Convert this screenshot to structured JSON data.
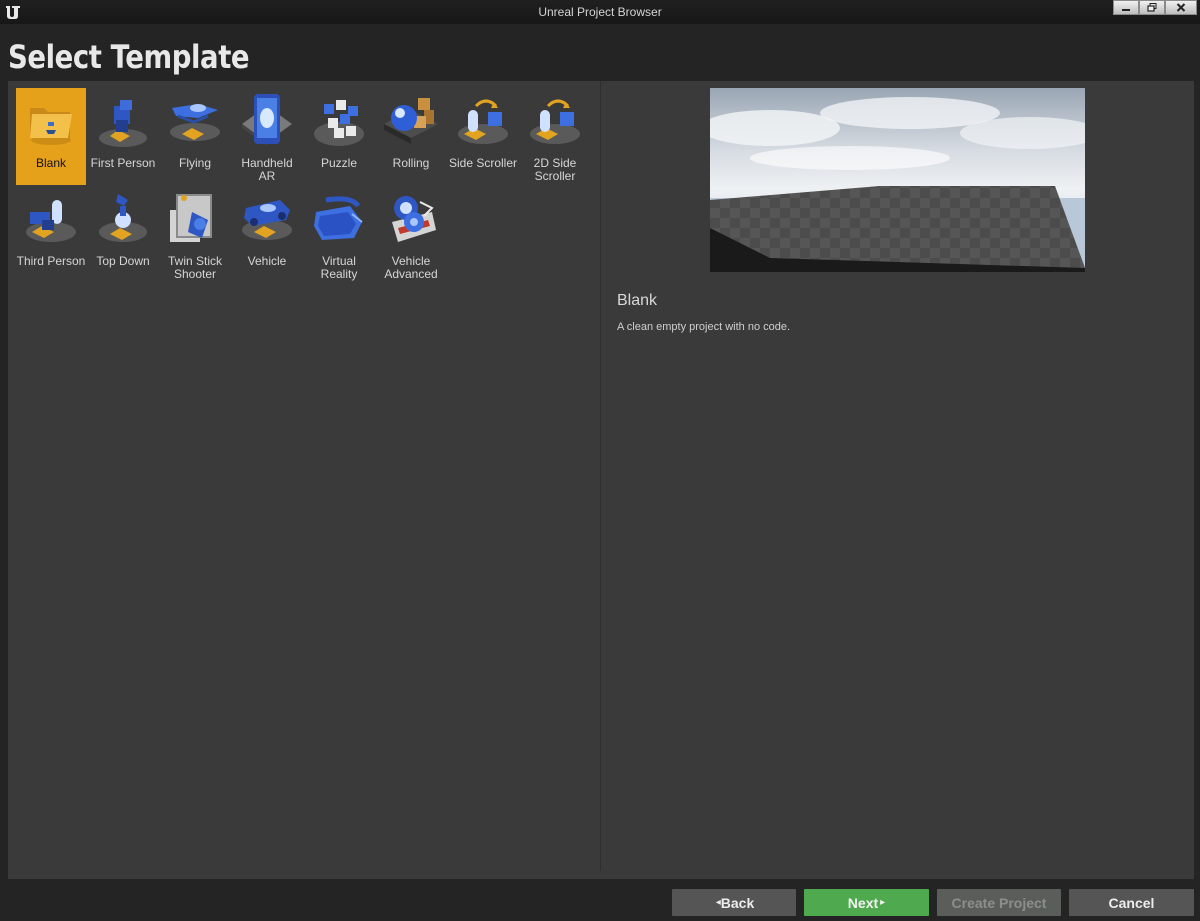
{
  "window": {
    "title": "Unreal Project Browser",
    "icons": [
      "ue-logo-icon",
      "minimize-icon",
      "restore-icon",
      "close-icon"
    ]
  },
  "page": {
    "title": "Select Template"
  },
  "templates": [
    {
      "label": "Blank",
      "icon": "folder-icon",
      "selected": true
    },
    {
      "label": "First Person",
      "icon": "first-person-icon",
      "selected": false
    },
    {
      "label": "Flying",
      "icon": "flying-icon",
      "selected": false
    },
    {
      "label": "Handheld AR",
      "icon": "handheld-ar-icon",
      "selected": false
    },
    {
      "label": "Puzzle",
      "icon": "puzzle-icon",
      "selected": false
    },
    {
      "label": "Rolling",
      "icon": "rolling-icon",
      "selected": false
    },
    {
      "label": "Side Scroller",
      "icon": "side-scroller-icon",
      "selected": false
    },
    {
      "label": "2D Side Scroller",
      "icon": "2d-side-scroller-icon",
      "selected": false
    },
    {
      "label": "Third Person",
      "icon": "third-person-icon",
      "selected": false
    },
    {
      "label": "Top Down",
      "icon": "top-down-icon",
      "selected": false
    },
    {
      "label": "Twin Stick Shooter",
      "icon": "twin-stick-shooter-icon",
      "selected": false
    },
    {
      "label": "Vehicle",
      "icon": "vehicle-icon",
      "selected": false
    },
    {
      "label": "Virtual Reality",
      "icon": "vr-headset-icon",
      "selected": false
    },
    {
      "label": "Vehicle Advanced",
      "icon": "vehicle-advanced-icon",
      "selected": false
    }
  ],
  "details": {
    "title": "Blank",
    "description": "A clean empty project with no code."
  },
  "buttons": {
    "back": "Back",
    "next": "Next",
    "create": "Create Project",
    "cancel": "Cancel"
  },
  "colors": {
    "selected_tile": "#e6a11b",
    "next_button": "#4fa94e",
    "panel_bg": "#3a3a3a",
    "window_bg": "#242424"
  }
}
